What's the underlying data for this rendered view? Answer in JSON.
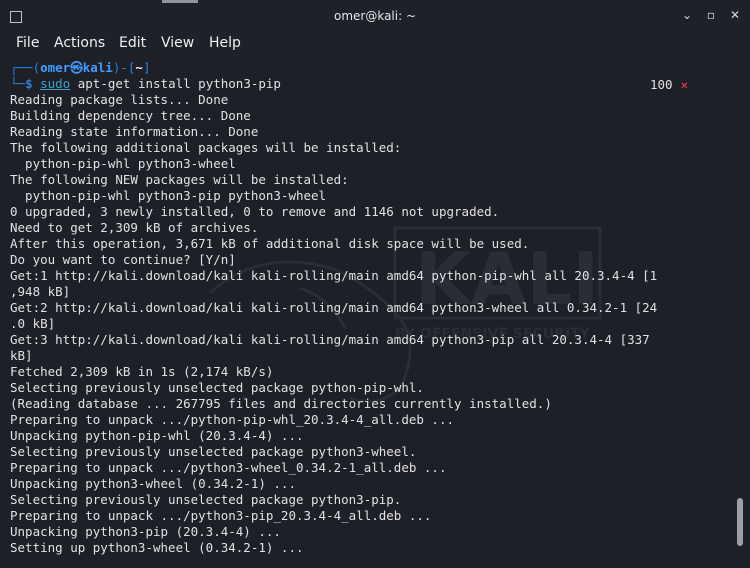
{
  "window": {
    "title": "omer@kali: ~"
  },
  "controls": {
    "minimize": "⌄",
    "maximize": "⌃",
    "restore": "▫",
    "close": "✕"
  },
  "menu": [
    "File",
    "Actions",
    "Edit",
    "View",
    "Help"
  ],
  "prompt": {
    "top_prefix": "┌──(",
    "user": "omer",
    "at": "㉿",
    "host": "kali",
    "mid": ")-[",
    "dir": "~",
    "top_suffix": "]",
    "bottom_prefix": "└─",
    "dollar": "$",
    "sudo": "sudo",
    "cmd": " apt-get install python3-pip"
  },
  "status_right": {
    "value": "100",
    "mark": "✕"
  },
  "output": [
    "Reading package lists... Done",
    "Building dependency tree... Done",
    "Reading state information... Done",
    "The following additional packages will be installed:",
    "  python-pip-whl python3-wheel",
    "The following NEW packages will be installed:",
    "  python-pip-whl python3-pip python3-wheel",
    "0 upgraded, 3 newly installed, 0 to remove and 1146 not upgraded.",
    "Need to get 2,309 kB of archives.",
    "After this operation, 3,671 kB of additional disk space will be used.",
    "Do you want to continue? [Y/n]",
    "Get:1 http://kali.download/kali kali-rolling/main amd64 python-pip-whl all 20.3.4-4 [1",
    ",948 kB]",
    "Get:2 http://kali.download/kali kali-rolling/main amd64 python3-wheel all 0.34.2-1 [24",
    ".0 kB]",
    "Get:3 http://kali.download/kali kali-rolling/main amd64 python3-pip all 20.3.4-4 [337",
    "kB]",
    "Fetched 2,309 kB in 1s (2,174 kB/s)",
    "Selecting previously unselected package python-pip-whl.",
    "(Reading database ... 267795 files and directories currently installed.)",
    "Preparing to unpack .../python-pip-whl_20.3.4-4_all.deb ...",
    "Unpacking python-pip-whl (20.3.4-4) ...",
    "Selecting previously unselected package python3-wheel.",
    "Preparing to unpack .../python3-wheel_0.34.2-1_all.deb ...",
    "Unpacking python3-wheel (0.34.2-1) ...",
    "Selecting previously unselected package python3-pip.",
    "Preparing to unpack .../python3-pip_20.3.4-4_all.deb ...",
    "Unpacking python3-pip (20.3.4-4) ...",
    "Setting up python3-wheel (0.34.2-1) ..."
  ],
  "colors": {
    "background": "#1e2027",
    "prompt": "#2f7fd6",
    "user": "#3f9cff",
    "error_mark": "#ff3b4b"
  }
}
